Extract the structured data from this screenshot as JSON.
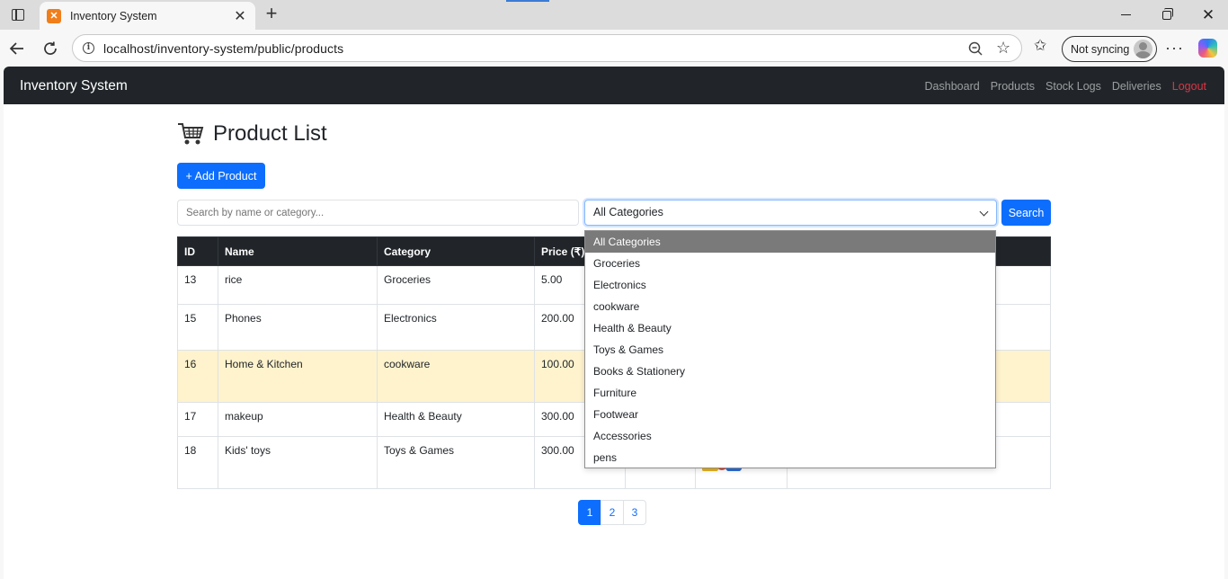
{
  "browser": {
    "tab_title": "Inventory System",
    "url": "localhost/inventory-system/public/products",
    "sync_label": "Not syncing"
  },
  "navbar": {
    "brand": "Inventory System",
    "links": [
      "Dashboard",
      "Products",
      "Stock Logs",
      "Deliveries"
    ],
    "logout": "Logout"
  },
  "page": {
    "title": "Product List",
    "add_button": "+ Add Product",
    "search_placeholder": "Search by name or category...",
    "category_selected": "All Categories",
    "search_button": "Search"
  },
  "table": {
    "headers": [
      "ID",
      "Name",
      "Category",
      "Price (₹)"
    ],
    "rows": [
      {
        "id": "13",
        "name": "rice",
        "category": "Groceries",
        "price": "5.00"
      },
      {
        "id": "15",
        "name": "Phones",
        "category": "Electronics",
        "price": "200.00"
      },
      {
        "id": "16",
        "name": "Home & Kitchen",
        "category": "cookware",
        "price": "100.00"
      },
      {
        "id": "17",
        "name": "makeup",
        "category": "Health & Beauty",
        "price": "300.00"
      },
      {
        "id": "18",
        "name": "Kids' toys",
        "category": "Toys & Games",
        "price": "300.00"
      }
    ]
  },
  "category_options": [
    "All Categories",
    "Groceries",
    "Electronics",
    "cookware",
    "Health & Beauty",
    "Toys & Games",
    "Books & Stationery",
    "Furniture",
    "Footwear",
    "Accessories",
    "pens"
  ],
  "pagination": [
    "1",
    "2",
    "3"
  ],
  "colors": {
    "primary": "#0d6efd",
    "navbar": "#212529",
    "logout": "#dc3545",
    "highlight_row": "#fff3cd"
  }
}
